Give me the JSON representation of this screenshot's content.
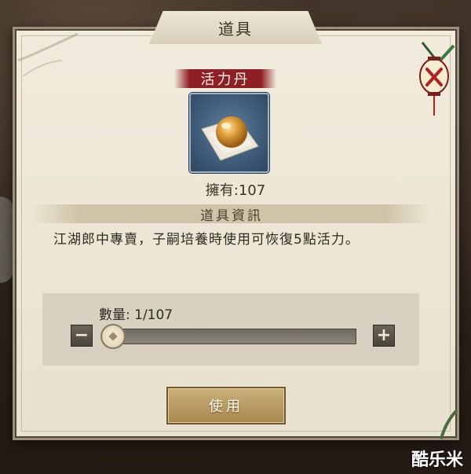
{
  "window": {
    "title": "道具"
  },
  "item": {
    "name": "活力丹",
    "owned": "擁有:107"
  },
  "info": {
    "header": "道具資訊",
    "description": "江湖郎中專賣，子嗣培養時使用可恢復5點活力。"
  },
  "quantity": {
    "label": "數量: 1/107",
    "value": 1,
    "max": 107
  },
  "buttons": {
    "use": "使用",
    "minus": "−",
    "plus": "+"
  },
  "watermark": "酷乐米",
  "colors": {
    "banner": "#8e1f24",
    "button": "#b7975b",
    "panel": "#ede6d5"
  }
}
